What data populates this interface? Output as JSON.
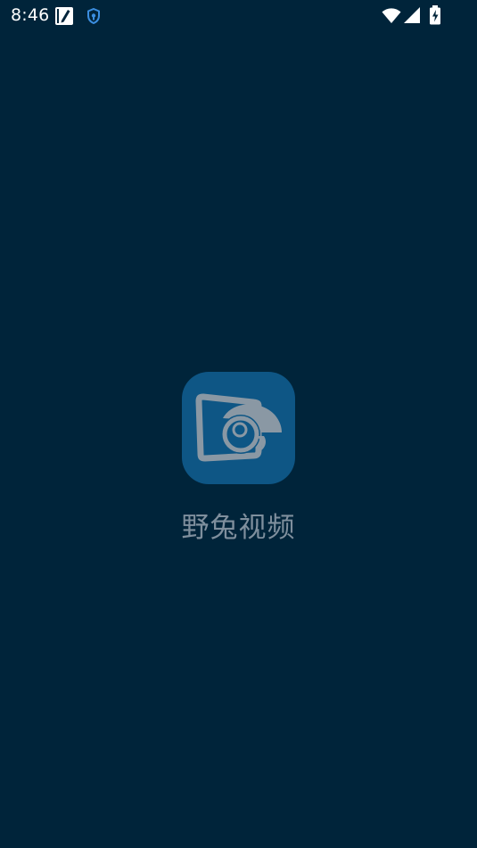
{
  "status_bar": {
    "time": "8:46"
  },
  "splash": {
    "app_name": "野兔视频"
  },
  "colors": {
    "background": "#00243a",
    "icon_bg": "#0e5685",
    "icon_glyph": "#8a98a4",
    "app_name_text": "#7f8f9d"
  },
  "icons": {
    "notification_1": "edit-note-icon",
    "notification_2": "shield-icon",
    "wifi": "wifi-icon",
    "signal": "cell-signal-icon",
    "battery": "battery-charging-icon",
    "app": "video-camera-logo-icon"
  }
}
